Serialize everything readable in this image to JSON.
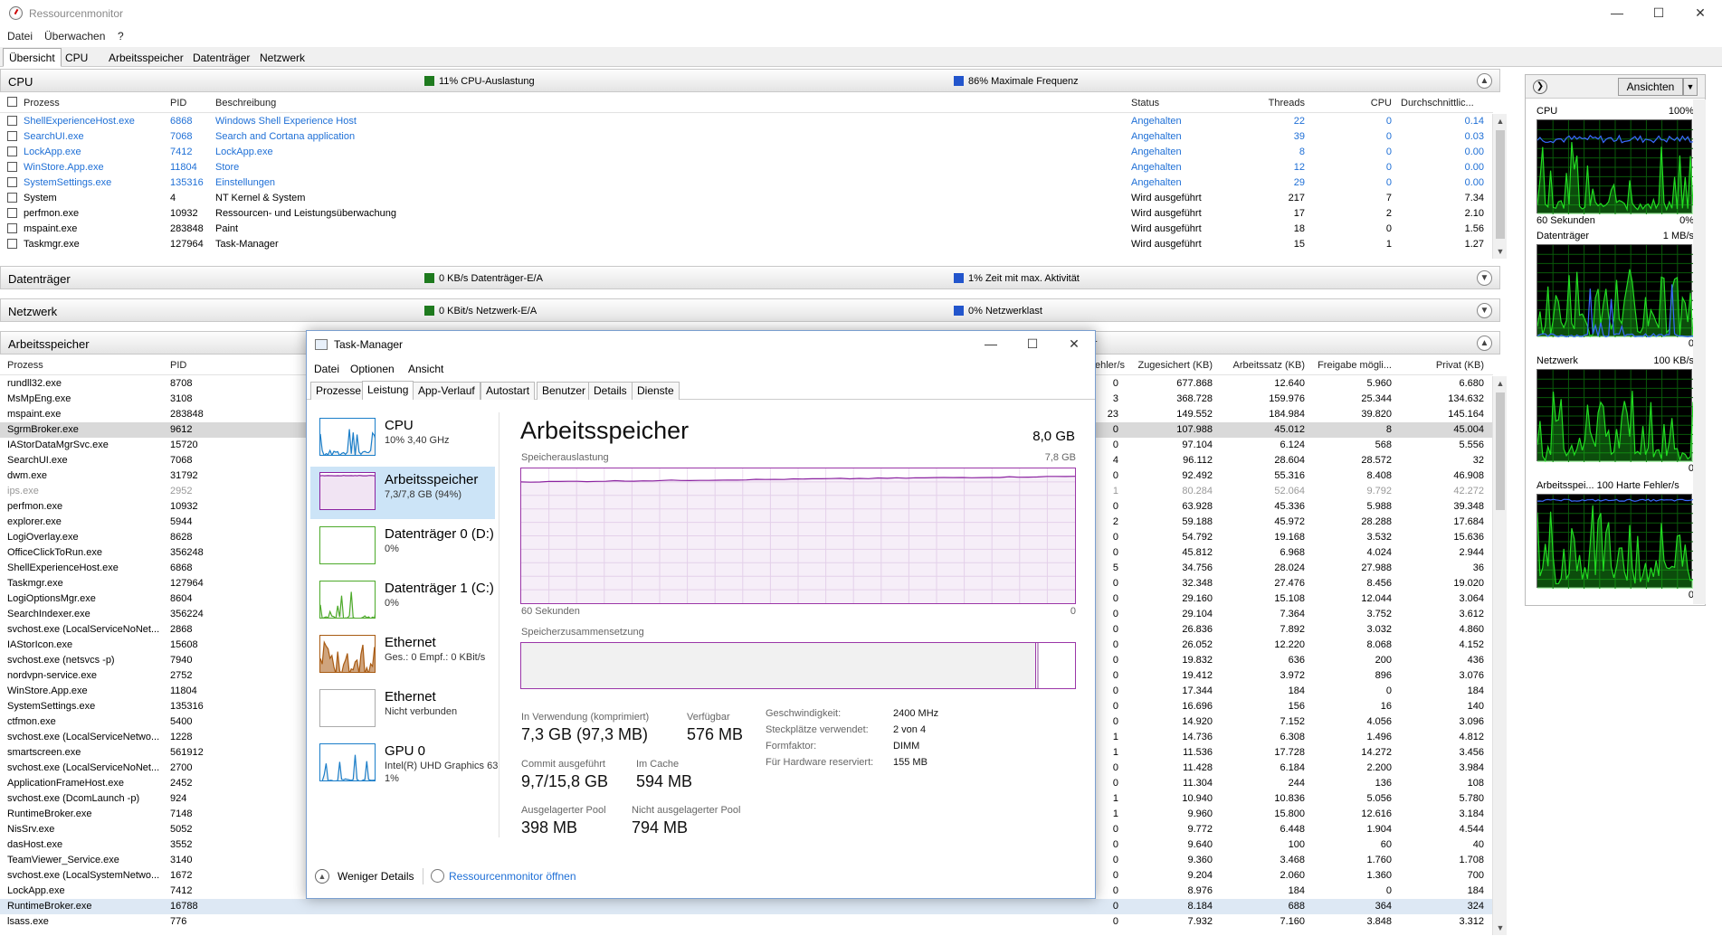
{
  "rm": {
    "title": "Ressourcenmonitor",
    "menu": [
      "Datei",
      "Überwachen",
      "?"
    ],
    "tabs": [
      "Übersicht",
      "CPU",
      "Arbeitsspeicher",
      "Datenträger",
      "Netzwerk"
    ],
    "cpu": {
      "title": "CPU",
      "ind1": "11% CPU-Auslastung",
      "ind2": "86% Maximale Frequenz",
      "ind1_color": "#1e7a1e",
      "ind2_color": "#2255cc",
      "columns": [
        "Prozess",
        "PID",
        "Beschreibung",
        "Status",
        "Threads",
        "CPU",
        "Durchschnittlic..."
      ],
      "rows": [
        {
          "name": "ShellExperienceHost.exe",
          "pid": "6868",
          "desc": "Windows Shell Experience Host",
          "status": "Angehalten",
          "threads": "22",
          "cpu": "0",
          "avg": "0.14",
          "style": "blue"
        },
        {
          "name": "SearchUI.exe",
          "pid": "7068",
          "desc": "Search and Cortana application",
          "status": "Angehalten",
          "threads": "39",
          "cpu": "0",
          "avg": "0.03",
          "style": "blue"
        },
        {
          "name": "LockApp.exe",
          "pid": "7412",
          "desc": "LockApp.exe",
          "status": "Angehalten",
          "threads": "8",
          "cpu": "0",
          "avg": "0.00",
          "style": "blue"
        },
        {
          "name": "WinStore.App.exe",
          "pid": "11804",
          "desc": "Store",
          "status": "Angehalten",
          "threads": "12",
          "cpu": "0",
          "avg": "0.00",
          "style": "blue"
        },
        {
          "name": "SystemSettings.exe",
          "pid": "135316",
          "desc": "Einstellungen",
          "status": "Angehalten",
          "threads": "29",
          "cpu": "0",
          "avg": "0.00",
          "style": "blue"
        },
        {
          "name": "System",
          "pid": "4",
          "desc": "NT Kernel & System",
          "status": "Wird ausgeführt",
          "threads": "217",
          "cpu": "7",
          "avg": "7.34",
          "style": ""
        },
        {
          "name": "perfmon.exe",
          "pid": "10932",
          "desc": "Ressourcen- und Leistungsüberwachung",
          "status": "Wird ausgeführt",
          "threads": "17",
          "cpu": "2",
          "avg": "2.10",
          "style": ""
        },
        {
          "name": "mspaint.exe",
          "pid": "283848",
          "desc": "Paint",
          "status": "Wird ausgeführt",
          "threads": "18",
          "cpu": "0",
          "avg": "1.56",
          "style": ""
        },
        {
          "name": "Taskmgr.exe",
          "pid": "127964",
          "desc": "Task-Manager",
          "status": "Wird ausgeführt",
          "threads": "15",
          "cpu": "1",
          "avg": "1.27",
          "style": ""
        }
      ]
    },
    "disk": {
      "title": "Datenträger",
      "ind1": "0 KB/s Datenträger-E/A",
      "ind2": "1% Zeit mit max. Aktivität"
    },
    "net": {
      "title": "Netzwerk",
      "ind1": "0 KBit/s Netzwerk-E/A",
      "ind2": "0% Netzwerklast"
    },
    "mem": {
      "title": "Arbeitsspeicher",
      "ind2_tail": "cher",
      "columns": [
        "Prozess",
        "PID",
        "ehler/s",
        "Zugesichert (KB)",
        "Arbeitssatz (KB)",
        "Freigabe mögli...",
        "Privat (KB)"
      ],
      "rows": [
        {
          "name": "rundll32.exe",
          "pid": "8708",
          "f": "0",
          "c": "677.868",
          "w": "12.640",
          "s": "5.960",
          "p": "6.680",
          "style": ""
        },
        {
          "name": "MsMpEng.exe",
          "pid": "3108",
          "f": "3",
          "c": "368.728",
          "w": "159.976",
          "s": "25.344",
          "p": "134.632",
          "style": ""
        },
        {
          "name": "mspaint.exe",
          "pid": "283848",
          "f": "23",
          "c": "149.552",
          "w": "184.984",
          "s": "39.820",
          "p": "145.164",
          "style": ""
        },
        {
          "name": "SgrmBroker.exe",
          "pid": "9612",
          "f": "0",
          "c": "107.988",
          "w": "45.012",
          "s": "8",
          "p": "45.004",
          "style": "sel"
        },
        {
          "name": "IAStorDataMgrSvc.exe",
          "pid": "15720",
          "f": "0",
          "c": "97.104",
          "w": "6.124",
          "s": "568",
          "p": "5.556",
          "style": ""
        },
        {
          "name": "SearchUI.exe",
          "pid": "7068",
          "f": "4",
          "c": "96.112",
          "w": "28.604",
          "s": "28.572",
          "p": "32",
          "style": ""
        },
        {
          "name": "dwm.exe",
          "pid": "31792",
          "f": "0",
          "c": "92.492",
          "w": "55.316",
          "s": "8.408",
          "p": "46.908",
          "style": ""
        },
        {
          "name": "ips.exe",
          "pid": "2952",
          "f": "1",
          "c": "80.284",
          "w": "52.064",
          "s": "9.792",
          "p": "42.272",
          "style": "grey"
        },
        {
          "name": "perfmon.exe",
          "pid": "10932",
          "f": "0",
          "c": "63.928",
          "w": "45.336",
          "s": "5.988",
          "p": "39.348",
          "style": ""
        },
        {
          "name": "explorer.exe",
          "pid": "5944",
          "f": "2",
          "c": "59.188",
          "w": "45.972",
          "s": "28.288",
          "p": "17.684",
          "style": ""
        },
        {
          "name": "LogiOverlay.exe",
          "pid": "8628",
          "f": "0",
          "c": "54.792",
          "w": "19.168",
          "s": "3.532",
          "p": "15.636",
          "style": ""
        },
        {
          "name": "OfficeClickToRun.exe",
          "pid": "356248",
          "f": "0",
          "c": "45.812",
          "w": "6.968",
          "s": "4.024",
          "p": "2.944",
          "style": ""
        },
        {
          "name": "ShellExperienceHost.exe",
          "pid": "6868",
          "f": "5",
          "c": "34.756",
          "w": "28.024",
          "s": "27.988",
          "p": "36",
          "style": ""
        },
        {
          "name": "Taskmgr.exe",
          "pid": "127964",
          "f": "0",
          "c": "32.348",
          "w": "27.476",
          "s": "8.456",
          "p": "19.020",
          "style": ""
        },
        {
          "name": "LogiOptionsMgr.exe",
          "pid": "8604",
          "f": "0",
          "c": "29.160",
          "w": "15.108",
          "s": "12.044",
          "p": "3.064",
          "style": ""
        },
        {
          "name": "SearchIndexer.exe",
          "pid": "356224",
          "f": "0",
          "c": "29.104",
          "w": "7.364",
          "s": "3.752",
          "p": "3.612",
          "style": ""
        },
        {
          "name": "svchost.exe (LocalServiceNoNet...",
          "pid": "2868",
          "f": "0",
          "c": "26.836",
          "w": "7.892",
          "s": "3.032",
          "p": "4.860",
          "style": ""
        },
        {
          "name": "IAStorIcon.exe",
          "pid": "15608",
          "f": "0",
          "c": "26.052",
          "w": "12.220",
          "s": "8.068",
          "p": "4.152",
          "style": ""
        },
        {
          "name": "svchost.exe (netsvcs -p)",
          "pid": "7940",
          "f": "0",
          "c": "19.832",
          "w": "636",
          "s": "200",
          "p": "436",
          "style": ""
        },
        {
          "name": "nordvpn-service.exe",
          "pid": "2752",
          "f": "0",
          "c": "19.412",
          "w": "3.972",
          "s": "896",
          "p": "3.076",
          "style": ""
        },
        {
          "name": "WinStore.App.exe",
          "pid": "11804",
          "f": "0",
          "c": "17.344",
          "w": "184",
          "s": "0",
          "p": "184",
          "style": ""
        },
        {
          "name": "SystemSettings.exe",
          "pid": "135316",
          "f": "0",
          "c": "16.696",
          "w": "156",
          "s": "16",
          "p": "140",
          "style": ""
        },
        {
          "name": "ctfmon.exe",
          "pid": "5400",
          "f": "0",
          "c": "14.920",
          "w": "7.152",
          "s": "4.056",
          "p": "3.096",
          "style": ""
        },
        {
          "name": "svchost.exe (LocalServiceNetwo...",
          "pid": "1228",
          "f": "1",
          "c": "14.736",
          "w": "6.308",
          "s": "1.496",
          "p": "4.812",
          "style": ""
        },
        {
          "name": "smartscreen.exe",
          "pid": "561912",
          "f": "1",
          "c": "11.536",
          "w": "17.728",
          "s": "14.272",
          "p": "3.456",
          "style": ""
        },
        {
          "name": "svchost.exe (LocalServiceNoNet...",
          "pid": "2700",
          "f": "0",
          "c": "11.428",
          "w": "6.184",
          "s": "2.200",
          "p": "3.984",
          "style": ""
        },
        {
          "name": "ApplicationFrameHost.exe",
          "pid": "2452",
          "f": "0",
          "c": "11.304",
          "w": "244",
          "s": "136",
          "p": "108",
          "style": ""
        },
        {
          "name": "svchost.exe (DcomLaunch -p)",
          "pid": "924",
          "f": "1",
          "c": "10.940",
          "w": "10.836",
          "s": "5.056",
          "p": "5.780",
          "style": ""
        },
        {
          "name": "RuntimeBroker.exe",
          "pid": "7148",
          "f": "1",
          "c": "9.960",
          "w": "15.800",
          "s": "12.616",
          "p": "3.184",
          "style": ""
        },
        {
          "name": "NisSrv.exe",
          "pid": "5052",
          "f": "0",
          "c": "9.772",
          "w": "6.448",
          "s": "1.904",
          "p": "4.544",
          "style": ""
        },
        {
          "name": "dasHost.exe",
          "pid": "3552",
          "f": "0",
          "c": "9.640",
          "w": "100",
          "s": "60",
          "p": "40",
          "style": ""
        },
        {
          "name": "TeamViewer_Service.exe",
          "pid": "3140",
          "f": "0",
          "c": "9.360",
          "w": "3.468",
          "s": "1.760",
          "p": "1.708",
          "style": ""
        },
        {
          "name": "svchost.exe (LocalSystemNetwo...",
          "pid": "1672",
          "f": "0",
          "c": "9.204",
          "w": "2.060",
          "s": "1.360",
          "p": "700",
          "style": ""
        },
        {
          "name": "LockApp.exe",
          "pid": "7412",
          "f": "0",
          "c": "8.976",
          "w": "184",
          "s": "0",
          "p": "184",
          "style": ""
        },
        {
          "name": "RuntimeBroker.exe",
          "pid": "16788",
          "f": "0",
          "c": "8.184",
          "w": "688",
          "s": "364",
          "p": "324",
          "style": "hilite"
        },
        {
          "name": "lsass.exe",
          "pid": "776",
          "f": "0",
          "c": "7.932",
          "w": "7.160",
          "s": "3.848",
          "p": "3.312",
          "style": ""
        }
      ]
    },
    "right": {
      "button": "Ansichten",
      "graphs": [
        {
          "label": "CPU",
          "max": "100%",
          "min": "0%",
          "extra": "60 Sekunden"
        },
        {
          "label": "Datenträger",
          "max": "1 MB/s",
          "min": "0",
          "extra": ""
        },
        {
          "label": "Netzwerk",
          "max": "100 KB/s",
          "min": "0",
          "extra": ""
        },
        {
          "label": "Arbeitsspei... 100 Harte Fehler/s",
          "max": "",
          "min": "0",
          "extra": ""
        }
      ]
    }
  },
  "tm": {
    "title": "Task-Manager",
    "menu": [
      "Datei",
      "Optionen",
      "Ansicht"
    ],
    "tabs": [
      "Prozesse",
      "Leistung",
      "App-Verlauf",
      "Autostart",
      "Benutzer",
      "Details",
      "Dienste"
    ],
    "perf": [
      {
        "t1": "CPU",
        "t2": "10% 3,40 GHz",
        "t3": "",
        "color": "#1b7ec9"
      },
      {
        "t1": "Arbeitsspeicher",
        "t2": "7,3/7,8 GB (94%)",
        "t3": "",
        "color": "#8b22a0"
      },
      {
        "t1": "Datenträger 0 (D:)",
        "t2": "0%",
        "t3": "",
        "color": "#4daa2a"
      },
      {
        "t1": "Datenträger 1 (C:)",
        "t2": "0%",
        "t3": "",
        "color": "#4daa2a"
      },
      {
        "t1": "Ethernet",
        "t2": "Ges.: 0 Empf.: 0 KBit/s",
        "t3": "",
        "color": "#a85a12"
      },
      {
        "t1": "Ethernet",
        "t2": "Nicht verbunden",
        "t3": "",
        "color": "#aaaaaa"
      },
      {
        "t1": "GPU 0",
        "t2": "Intel(R) UHD Graphics 63",
        "t3": "1%",
        "color": "#1b7ec9"
      }
    ],
    "main": {
      "title": "Arbeitsspeicher",
      "total": "8,0 GB",
      "usage_label": "Speicherauslastung",
      "usage_max": "7,8 GB",
      "time_left": "60 Sekunden",
      "time_right": "0",
      "comp_label": "Speicherzusammensetzung",
      "in_use_fraction": 0.93,
      "stats": [
        {
          "l": "In Verwendung (komprimiert)",
          "v": "7,3 GB (97,3 MB)"
        },
        {
          "l": "Verfügbar",
          "v": "576 MB"
        },
        {
          "l": "Commit ausgeführt",
          "v": "9,7/15,8 GB"
        },
        {
          "l": "Im Cache",
          "v": "594 MB"
        },
        {
          "l": "Ausgelagerter Pool",
          "v": "398 MB"
        },
        {
          "l": "Nicht ausgelagerter Pool",
          "v": "794 MB"
        }
      ],
      "kv": [
        {
          "k": "Geschwindigkeit:",
          "v": "2400 MHz"
        },
        {
          "k": "Steckplätze verwendet:",
          "v": "2 von 4"
        },
        {
          "k": "Formfaktor:",
          "v": "DIMM"
        },
        {
          "k": "Für Hardware reserviert:",
          "v": "155 MB"
        }
      ]
    },
    "footer": {
      "less": "Weniger Details",
      "open": "Ressourcenmonitor öffnen"
    }
  }
}
